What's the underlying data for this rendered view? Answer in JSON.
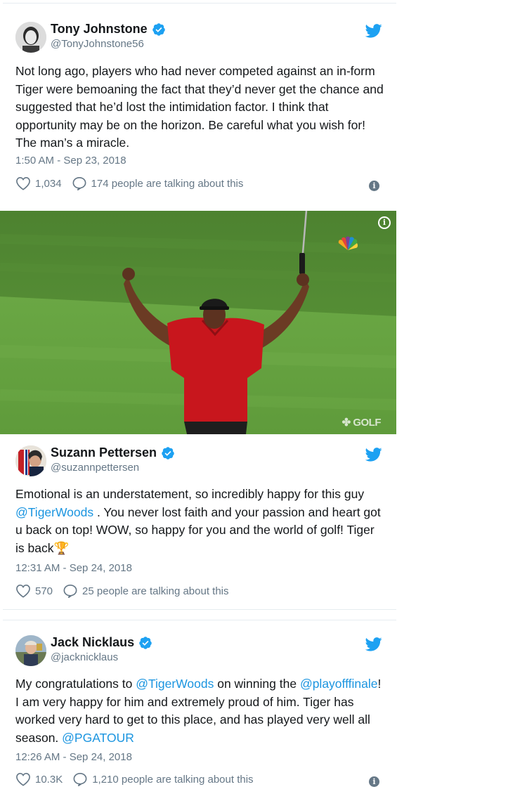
{
  "tweets": [
    {
      "name": "Tony Johnstone",
      "handle": "@TonyJohnstone56",
      "text": "Not long ago,  players who had never competed against an in-form Tiger were bemoaning the fact that they’d never get the chance and suggested that he’d lost the intimidation factor. I think that opportunity may be on the horizon. Be careful what you wish for! The man’s a miracle.",
      "time": "1:50 AM - Sep 23, 2018",
      "likes": "1,034",
      "talking": "174 people are talking about this"
    },
    {
      "name": "Suzann Pettersen",
      "handle": "@suzannpettersen",
      "text_parts": {
        "p1": "Emotional is an understatement, so incredibly happy for this guy ",
        "m1": "@TigerWoods",
        "p2": " . You never lost faith and your passion and heart got u back on top! WOW, so happy for you and the world of golf! Tiger is back",
        "emoji": "🏆"
      },
      "time": "12:31 AM - Sep 24, 2018",
      "likes": "570",
      "talking": "25 people are talking about this"
    },
    {
      "name": "Jack Nicklaus",
      "handle": "@jacknicklaus",
      "text_parts": {
        "p1": "My congratulations to ",
        "m1": "@TigerWoods",
        "p2": " on winning the ",
        "m2": "@playofffinale",
        "p3": "! I am very happy for him and extremely proud of him. Tiger has worked very hard to get to this place, and has played very well all season. ",
        "m3": "@PGATOUR"
      },
      "time": "12:26 AM - Sep 24, 2018",
      "likes": "10.3K",
      "talking": "1,210 people are talking about this"
    }
  ],
  "media": {
    "watermark": "GOLF",
    "info_glyph": "i"
  },
  "icons": {
    "verified": "verified-badge-icon",
    "bird": "twitter-bird-icon",
    "heart": "heart-icon",
    "reply": "reply-bubble-icon",
    "info": "info-icon"
  },
  "colors": {
    "link": "#1b95e0",
    "secondary_text": "#657786",
    "primary_text": "#14171a",
    "tiger_shirt": "#c8161d"
  }
}
